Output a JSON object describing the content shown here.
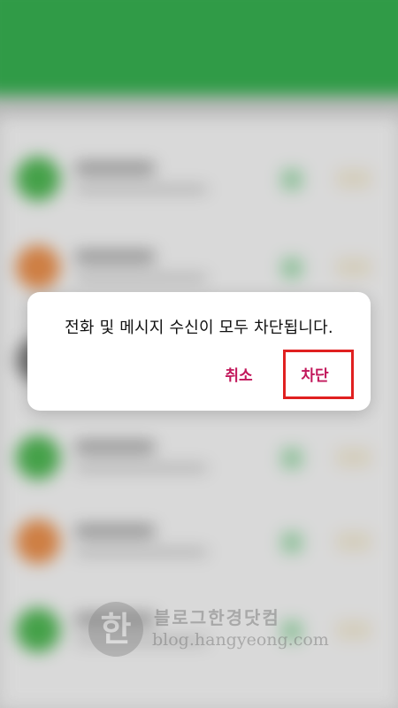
{
  "dialog": {
    "message": "전화 및 메시지 수신이 모두 차단됩니다.",
    "cancel_label": "취소",
    "block_label": "차단"
  },
  "background": {
    "header_color": "#35a94e",
    "avatar_colors": [
      "#4caf50",
      "#e08a4a",
      "#7a7a7a",
      "#4caf50",
      "#e08a4a",
      "#4caf50"
    ]
  },
  "watermark": {
    "seal_char": "한",
    "title": "블로그한경닷컴",
    "url": "blog.hangyeong.com"
  },
  "colors": {
    "accent": "#c2185b",
    "highlight": "#e02020"
  }
}
